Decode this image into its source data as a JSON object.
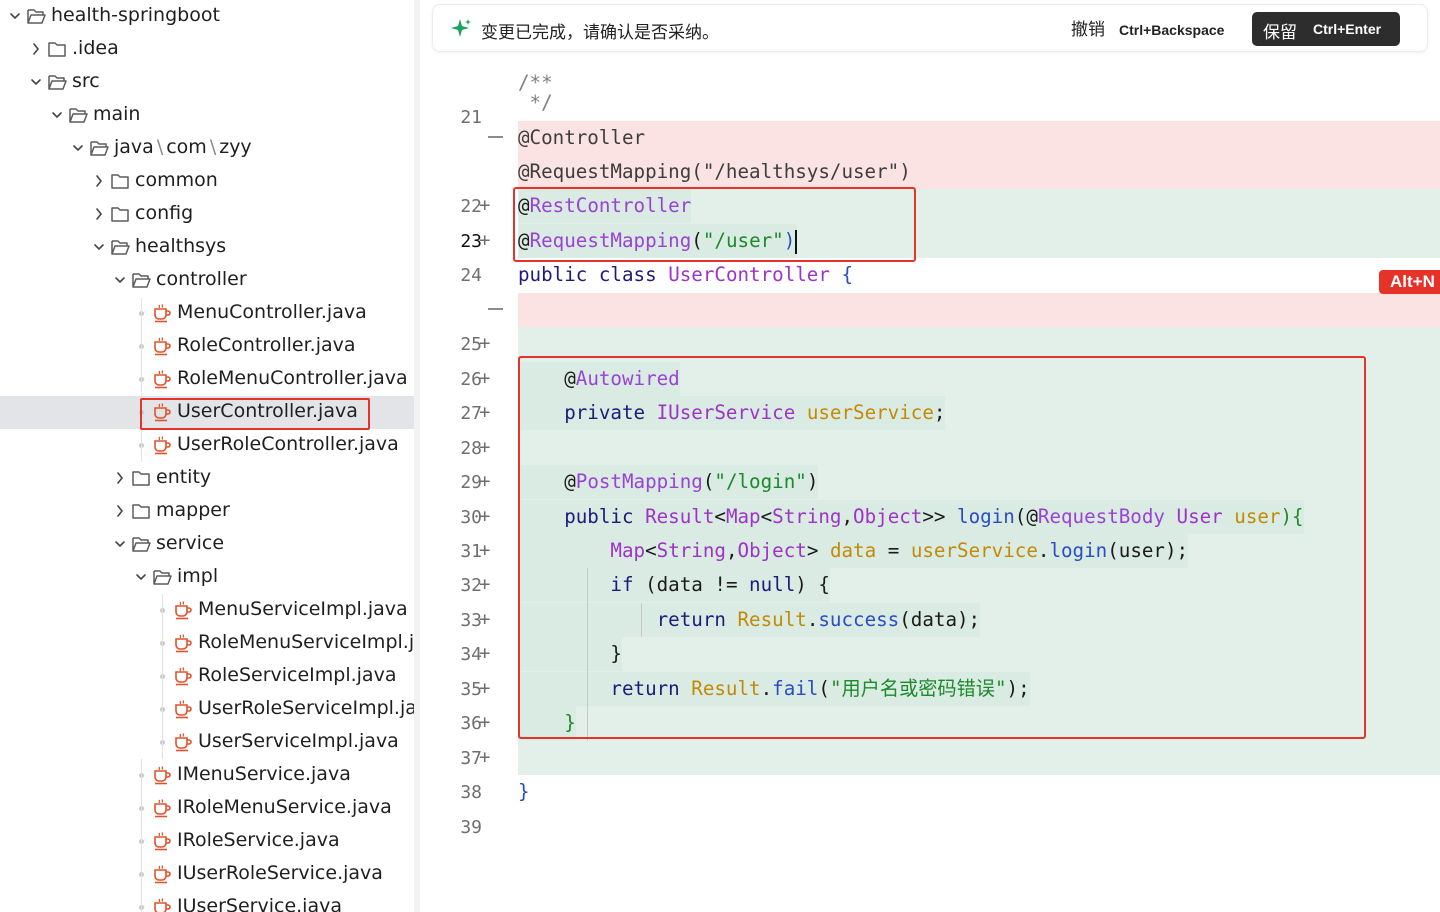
{
  "tree": {
    "items": [
      {
        "label": "health-springboot",
        "icon": "folder-open-icon",
        "expanded": true,
        "depth": 0
      },
      {
        "label": ".idea",
        "icon": "folder-icon",
        "expanded": false,
        "depth": 1
      },
      {
        "label": "src",
        "icon": "folder-open-icon",
        "expanded": true,
        "depth": 1
      },
      {
        "label": "main",
        "icon": "folder-open-icon",
        "expanded": true,
        "depth": 2
      },
      {
        "label_parts": [
          "java",
          "\\",
          "com",
          "\\",
          "zyy"
        ],
        "icon": "folder-open-icon",
        "expanded": true,
        "depth": 3
      },
      {
        "label": "common",
        "icon": "folder-icon",
        "expanded": false,
        "depth": 4
      },
      {
        "label": "config",
        "icon": "folder-icon",
        "expanded": false,
        "depth": 4
      },
      {
        "label": "healthsys",
        "icon": "folder-open-icon",
        "expanded": true,
        "depth": 4
      },
      {
        "label": "controller",
        "icon": "folder-open-icon",
        "expanded": true,
        "depth": 5
      },
      {
        "label": "MenuController.java",
        "icon": "java-file-icon",
        "depth": 6
      },
      {
        "label": "RoleController.java",
        "icon": "java-file-icon",
        "depth": 6
      },
      {
        "label": "RoleMenuController.java",
        "icon": "java-file-icon",
        "depth": 6
      },
      {
        "label": "UserController.java",
        "icon": "java-file-icon",
        "depth": 6,
        "selected": true
      },
      {
        "label": "UserRoleController.java",
        "icon": "java-file-icon",
        "depth": 6
      },
      {
        "label": "entity",
        "icon": "folder-icon",
        "expanded": false,
        "depth": 5
      },
      {
        "label": "mapper",
        "icon": "folder-icon",
        "expanded": false,
        "depth": 5
      },
      {
        "label": "service",
        "icon": "folder-open-icon",
        "expanded": true,
        "depth": 5
      },
      {
        "label": "impl",
        "icon": "folder-open-icon",
        "expanded": true,
        "depth": 6
      },
      {
        "label": "MenuServiceImpl.java",
        "icon": "java-file-icon",
        "depth": 7
      },
      {
        "label": "RoleMenuServiceImpl.j...",
        "icon": "java-file-icon",
        "depth": 7
      },
      {
        "label": "RoleServiceImpl.java",
        "icon": "java-file-icon",
        "depth": 7
      },
      {
        "label": "UserRoleServiceImpl.java",
        "icon": "java-file-icon",
        "depth": 7
      },
      {
        "label": "UserServiceImpl.java",
        "icon": "java-file-icon",
        "depth": 7
      },
      {
        "label": "IMenuService.java",
        "icon": "java-file-icon",
        "depth": 6
      },
      {
        "label": "IRoleMenuService.java",
        "icon": "java-file-icon",
        "depth": 6
      },
      {
        "label": "IRoleService.java",
        "icon": "java-file-icon",
        "depth": 6
      },
      {
        "label": "IUserRoleService.java",
        "icon": "java-file-icon",
        "depth": 6
      },
      {
        "label": "IUserService.java",
        "icon": "java-file-icon",
        "depth": 6
      }
    ]
  },
  "notice": {
    "icon": "sparkle-icon",
    "message": "变更已完成，请确认是否采纳。",
    "undo_label": "撤销",
    "undo_shortcut": "Ctrl+Backspace",
    "keep_label": "保留",
    "keep_shortcut": "Ctrl+Enter"
  },
  "badge": "Alt+N",
  "editor": {
    "current_line": "23",
    "lines": [
      {
        "num": "",
        "plus": false,
        "code": [
          {
            "t": "/**",
            "c": "g"
          }
        ]
      },
      {
        "num": "21",
        "plus": false,
        "code": [
          {
            "t": " */",
            "c": "g"
          }
        ]
      },
      {
        "num": "",
        "minus": true,
        "code": [
          {
            "t": "@Controller",
            "c": "dk"
          }
        ]
      },
      {
        "num": "",
        "minus": false,
        "code": [
          {
            "t": "@RequestMapping(\"/healthsys/user\")",
            "c": "dk"
          }
        ]
      },
      {
        "num": "22",
        "plus": true,
        "code": [
          {
            "t": "@",
            "c": ""
          },
          {
            "t": "RestController",
            "c": "a"
          }
        ]
      },
      {
        "num": "23",
        "plus": true,
        "code": [
          {
            "t": "@",
            "c": ""
          },
          {
            "t": "RequestMapping",
            "c": "a"
          },
          {
            "t": "(",
            "c": ""
          },
          {
            "t": "\"/user\"",
            "c": "s"
          },
          {
            "t": ")",
            "c": "m"
          }
        ]
      },
      {
        "num": "24",
        "plus": false,
        "code": [
          {
            "t": "public class ",
            "c": "k"
          },
          {
            "t": "UserController",
            "c": "t"
          },
          {
            "t": " {",
            "c": "m"
          }
        ]
      },
      {
        "num": "",
        "minus": true,
        "code": []
      },
      {
        "num": "25",
        "plus": true,
        "code": []
      },
      {
        "num": "26",
        "plus": true,
        "code": [
          {
            "t": "    @",
            "c": ""
          },
          {
            "t": "Autowired",
            "c": "a"
          }
        ]
      },
      {
        "num": "27",
        "plus": true,
        "code": [
          {
            "t": "    private ",
            "c": "k"
          },
          {
            "t": "IUserService ",
            "c": "t"
          },
          {
            "t": "userService",
            "c": "f"
          },
          {
            "t": ";",
            "c": ""
          }
        ]
      },
      {
        "num": "28",
        "plus": true,
        "code": []
      },
      {
        "num": "29",
        "plus": true,
        "code": [
          {
            "t": "    @",
            "c": ""
          },
          {
            "t": "PostMapping",
            "c": "a"
          },
          {
            "t": "(",
            "c": ""
          },
          {
            "t": "\"/login\"",
            "c": "s"
          },
          {
            "t": ")",
            "c": ""
          }
        ]
      },
      {
        "num": "30",
        "plus": true,
        "code": [
          {
            "t": "    public ",
            "c": "k"
          },
          {
            "t": "Result",
            "c": "t"
          },
          {
            "t": "<",
            "c": ""
          },
          {
            "t": "Map",
            "c": "t"
          },
          {
            "t": "<",
            "c": ""
          },
          {
            "t": "String",
            "c": "t"
          },
          {
            "t": ",",
            "c": ""
          },
          {
            "t": "Object",
            "c": "t"
          },
          {
            "t": ">> ",
            "c": ""
          },
          {
            "t": "login",
            "c": "m"
          },
          {
            "t": "(@",
            "c": ""
          },
          {
            "t": "RequestBody ",
            "c": "a"
          },
          {
            "t": "User ",
            "c": "t"
          },
          {
            "t": "user",
            "c": "f"
          },
          {
            "t": "){",
            "c": "s"
          }
        ]
      },
      {
        "num": "31",
        "plus": true,
        "code": [
          {
            "t": "        ",
            "c": ""
          },
          {
            "t": "Map",
            "c": "t"
          },
          {
            "t": "<",
            "c": ""
          },
          {
            "t": "String",
            "c": "t"
          },
          {
            "t": ",",
            "c": ""
          },
          {
            "t": "Object",
            "c": "t"
          },
          {
            "t": "> ",
            "c": ""
          },
          {
            "t": "data",
            "c": "f"
          },
          {
            "t": " = ",
            "c": ""
          },
          {
            "t": "userService",
            "c": "f"
          },
          {
            "t": ".",
            "c": ""
          },
          {
            "t": "login",
            "c": "m"
          },
          {
            "t": "(user);",
            "c": ""
          }
        ]
      },
      {
        "num": "32",
        "plus": true,
        "code": [
          {
            "t": "        if ",
            "c": "k"
          },
          {
            "t": "(data != ",
            "c": ""
          },
          {
            "t": "null",
            "c": "k"
          },
          {
            "t": ") {",
            "c": ""
          }
        ]
      },
      {
        "num": "33",
        "plus": true,
        "code": [
          {
            "t": "            return ",
            "c": "k"
          },
          {
            "t": "Result",
            "c": "f"
          },
          {
            "t": ".",
            "c": ""
          },
          {
            "t": "success",
            "c": "m"
          },
          {
            "t": "(data);",
            "c": ""
          }
        ]
      },
      {
        "num": "34",
        "plus": true,
        "code": [
          {
            "t": "        }",
            "c": ""
          }
        ]
      },
      {
        "num": "35",
        "plus": true,
        "code": [
          {
            "t": "        return ",
            "c": "k"
          },
          {
            "t": "Result",
            "c": "f"
          },
          {
            "t": ".",
            "c": ""
          },
          {
            "t": "fail",
            "c": "m"
          },
          {
            "t": "(",
            "c": ""
          },
          {
            "t": "\"用户名或密码错误\"",
            "c": "s"
          },
          {
            "t": ");",
            "c": ""
          }
        ]
      },
      {
        "num": "36",
        "plus": true,
        "code": [
          {
            "t": "    }",
            "c": "s"
          }
        ]
      },
      {
        "num": "37",
        "plus": true,
        "code": []
      },
      {
        "num": "38",
        "plus": false,
        "code": [
          {
            "t": "}",
            "c": "m"
          }
        ]
      },
      {
        "num": "39",
        "plus": false,
        "code": []
      }
    ]
  }
}
